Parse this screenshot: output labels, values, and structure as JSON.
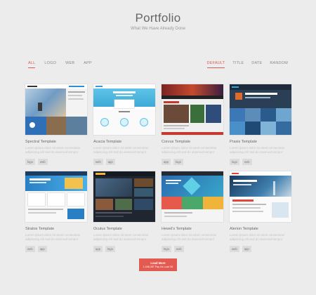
{
  "header": {
    "title": "Portfolio",
    "subtitle": "What We Have Already Done"
  },
  "filters": [
    "ALL",
    "LOGO",
    "WEB",
    "APP"
  ],
  "sorts": [
    "DEFAULT",
    "TITLE",
    "DATE",
    "RANDOM"
  ],
  "description_placeholder": "Lorem ipsum dolor sit amet consectetur adipiscing elit sed do eiusmod tempor",
  "cards": [
    {
      "title": "Spectral Template",
      "tags": [
        "logo",
        "web"
      ]
    },
    {
      "title": "Acacia Template",
      "tags": [
        "web",
        "app"
      ]
    },
    {
      "title": "Corvus Template",
      "tags": [
        "app",
        "logo"
      ]
    },
    {
      "title": "Praxis Template",
      "tags": [
        "logo",
        "web"
      ]
    },
    {
      "title": "Stratos Template",
      "tags": [
        "web",
        "app"
      ]
    },
    {
      "title": "Oculus Template",
      "tags": [
        "app",
        "logo"
      ]
    },
    {
      "title": "Hewel's Template",
      "tags": [
        "logo",
        "web"
      ]
    },
    {
      "title": "Alerion Template",
      "tags": [
        "web",
        "app"
      ]
    }
  ],
  "load_more": {
    "label": "Load More",
    "status": "1,048,387 Pay Us Load 98"
  },
  "colors": {
    "accent": "#e05a4f",
    "background": "#ececec"
  }
}
